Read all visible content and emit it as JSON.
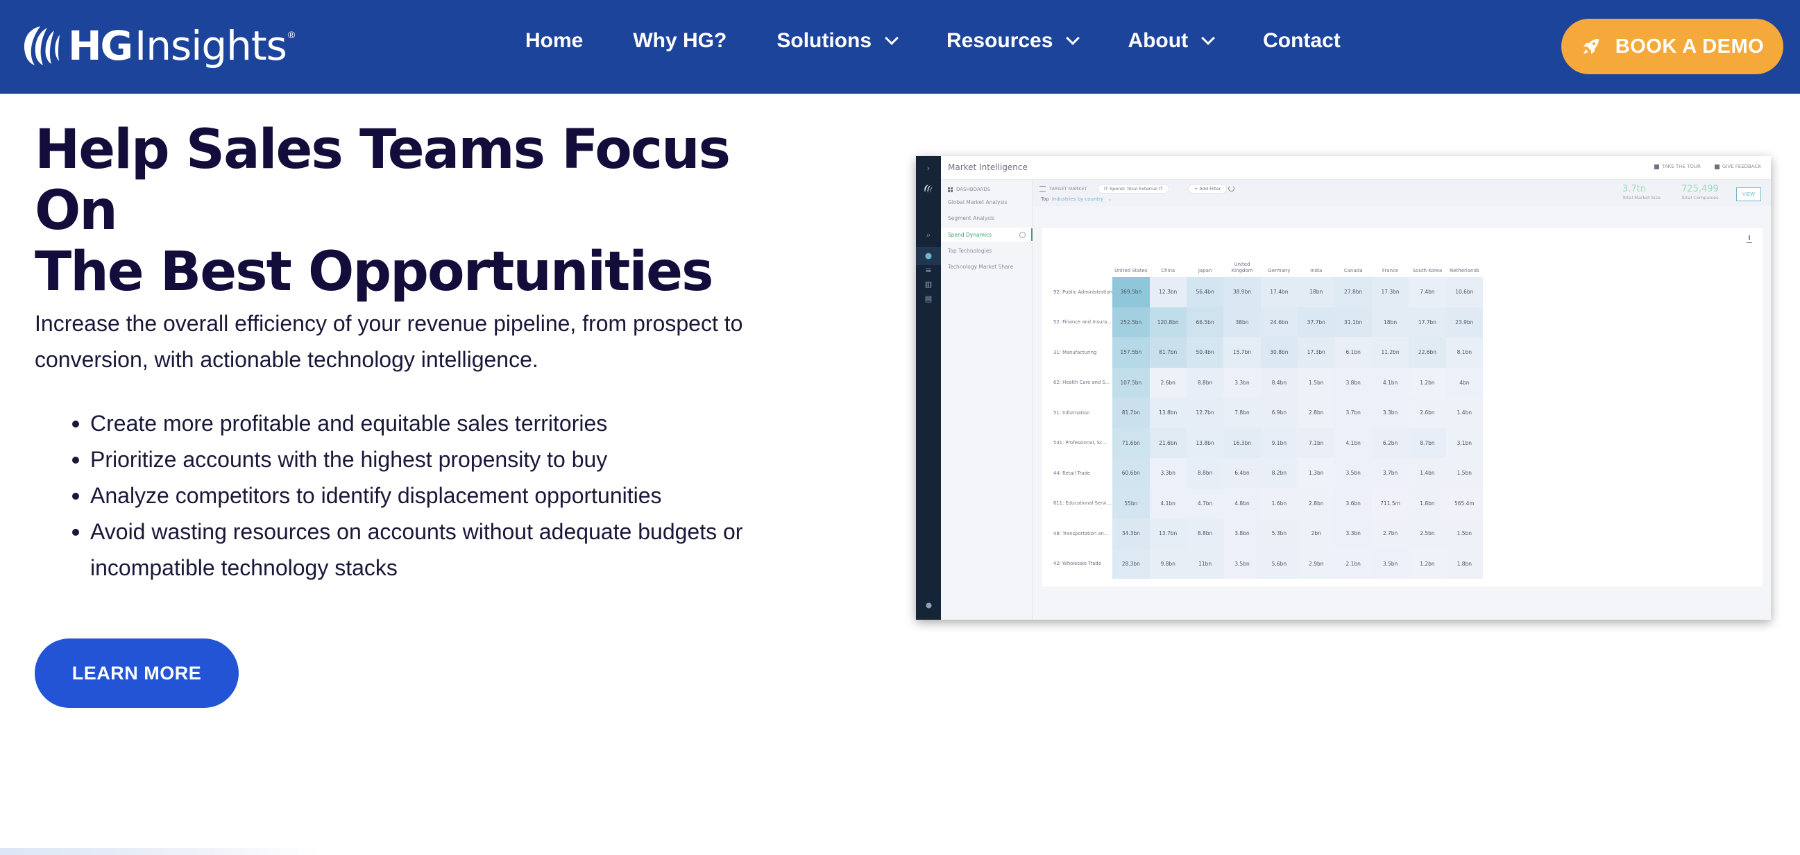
{
  "brand": {
    "logo_bold": "HG",
    "logo_light": "Insights",
    "registered": "®",
    "colors": {
      "header_bg": "#1d449b",
      "cta_orange": "#f5a93a",
      "learn_more_blue": "#2354d6",
      "heading_navy": "#120d3a",
      "dashboard_accent_green": "#3f9e74",
      "dashboard_accent_teal": "#6fb8c9"
    }
  },
  "nav": {
    "items": [
      {
        "label": "Home",
        "has_dropdown": false
      },
      {
        "label": "Why HG?",
        "has_dropdown": false
      },
      {
        "label": "Solutions",
        "has_dropdown": true
      },
      {
        "label": "Resources",
        "has_dropdown": true
      },
      {
        "label": "About",
        "has_dropdown": true
      },
      {
        "label": "Contact",
        "has_dropdown": false
      }
    ],
    "cta_label": "BOOK A DEMO",
    "cta_icon": "rocket-icon"
  },
  "hero": {
    "title_line1": "Help Sales Teams Focus On",
    "title_line2": "The Best Opportunities",
    "subtitle": "Increase the overall efficiency of your revenue pipeline, from prospect to conversion, with actionable technology intelligence.",
    "bullets": [
      "Create more profitable and equitable sales territories",
      "Prioritize accounts with the highest propensity to buy",
      "Analyze competitors to identify displacement opportunities",
      "Avoid wasting resources on accounts without adequate budgets or incompatible technology stacks"
    ],
    "learn_more_label": "LEARN MORE"
  },
  "dashboard": {
    "title": "Market Intelligence",
    "header_links": [
      "TAKE THE TOUR",
      "GIVE FEEDBACK"
    ],
    "sidebar": {
      "heading": "DASHBOARDS",
      "items": [
        {
          "label": "Global Market Analysis",
          "active": false
        },
        {
          "label": "Segment Analysis",
          "active": false
        },
        {
          "label": "Spend Dynamics",
          "active": true
        },
        {
          "label": "Top Technologies",
          "active": false
        },
        {
          "label": "Technology Market Share",
          "active": false
        }
      ]
    },
    "filter": {
      "label": "TARGET MARKET",
      "chip": "IT Spend: Total External IT",
      "add_filter": "+ Add Filter",
      "top_label": "Top",
      "top_select": "Industries by country"
    },
    "kpis": [
      {
        "value": "3.7tn",
        "label": "Total Market Size"
      },
      {
        "value": "725,499",
        "label": "Total Companies"
      }
    ],
    "view_label": "VIEW",
    "table": {
      "columns": [
        "United States",
        "China",
        "Japan",
        "United Kingdom",
        "Germany",
        "India",
        "Canada",
        "France",
        "South Korea",
        "Netherlands"
      ],
      "rows": [
        {
          "label": "92: Public Administration",
          "values": [
            "369.5bn",
            "12.3bn",
            "56.4bn",
            "38.9bn",
            "17.4bn",
            "18bn",
            "27.8bn",
            "17.3bn",
            "7.4bn",
            "10.6bn"
          ]
        },
        {
          "label": "52: Finance and Insura...",
          "values": [
            "252.5bn",
            "120.8bn",
            "66.5bn",
            "38bn",
            "24.6bn",
            "37.7bn",
            "31.1bn",
            "18bn",
            "17.7bn",
            "23.9bn"
          ]
        },
        {
          "label": "31: Manufacturing",
          "values": [
            "157.5bn",
            "81.7bn",
            "50.4bn",
            "15.7bn",
            "30.8bn",
            "17.3bn",
            "6.1bn",
            "11.2bn",
            "22.6bn",
            "8.1bn"
          ]
        },
        {
          "label": "62: Health Care and S...",
          "values": [
            "107.5bn",
            "2.6bn",
            "8.8bn",
            "3.3bn",
            "8.4bn",
            "1.5bn",
            "3.8bn",
            "4.1bn",
            "1.2bn",
            "4bn"
          ]
        },
        {
          "label": "51: Information",
          "values": [
            "81.7bn",
            "13.8bn",
            "12.7bn",
            "7.8bn",
            "6.9bn",
            "2.8bn",
            "3.7bn",
            "3.3bn",
            "2.6bn",
            "1.4bn"
          ]
        },
        {
          "label": "541: Professional, Sc...",
          "values": [
            "71.6bn",
            "21.6bn",
            "13.8bn",
            "16.3bn",
            "9.1bn",
            "7.1bn",
            "4.1bn",
            "6.2bn",
            "8.7bn",
            "3.1bn"
          ]
        },
        {
          "label": "44: Retail Trade",
          "values": [
            "60.6bn",
            "3.3bn",
            "8.8bn",
            "6.4bn",
            "8.2bn",
            "1.3bn",
            "3.5bn",
            "3.7bn",
            "1.4bn",
            "1.5bn"
          ]
        },
        {
          "label": "611: Educational Servi...",
          "values": [
            "55bn",
            "4.1bn",
            "4.7bn",
            "4.8bn",
            "1.6bn",
            "2.8bn",
            "3.6bn",
            "711.5m",
            "1.8bn",
            "565.4m"
          ]
        },
        {
          "label": "48: Transportation an...",
          "values": [
            "34.3bn",
            "13.7bn",
            "8.8bn",
            "3.8bn",
            "5.3bn",
            "2bn",
            "3.3bn",
            "2.7bn",
            "2.5bn",
            "1.5bn"
          ]
        },
        {
          "label": "42: Wholesale Trade",
          "values": [
            "28.3bn",
            "9.8bn",
            "11bn",
            "3.5bn",
            "5.6bn",
            "2.9bn",
            "2.1bn",
            "3.5bn",
            "1.2bn",
            "1.8bn"
          ]
        }
      ]
    }
  }
}
